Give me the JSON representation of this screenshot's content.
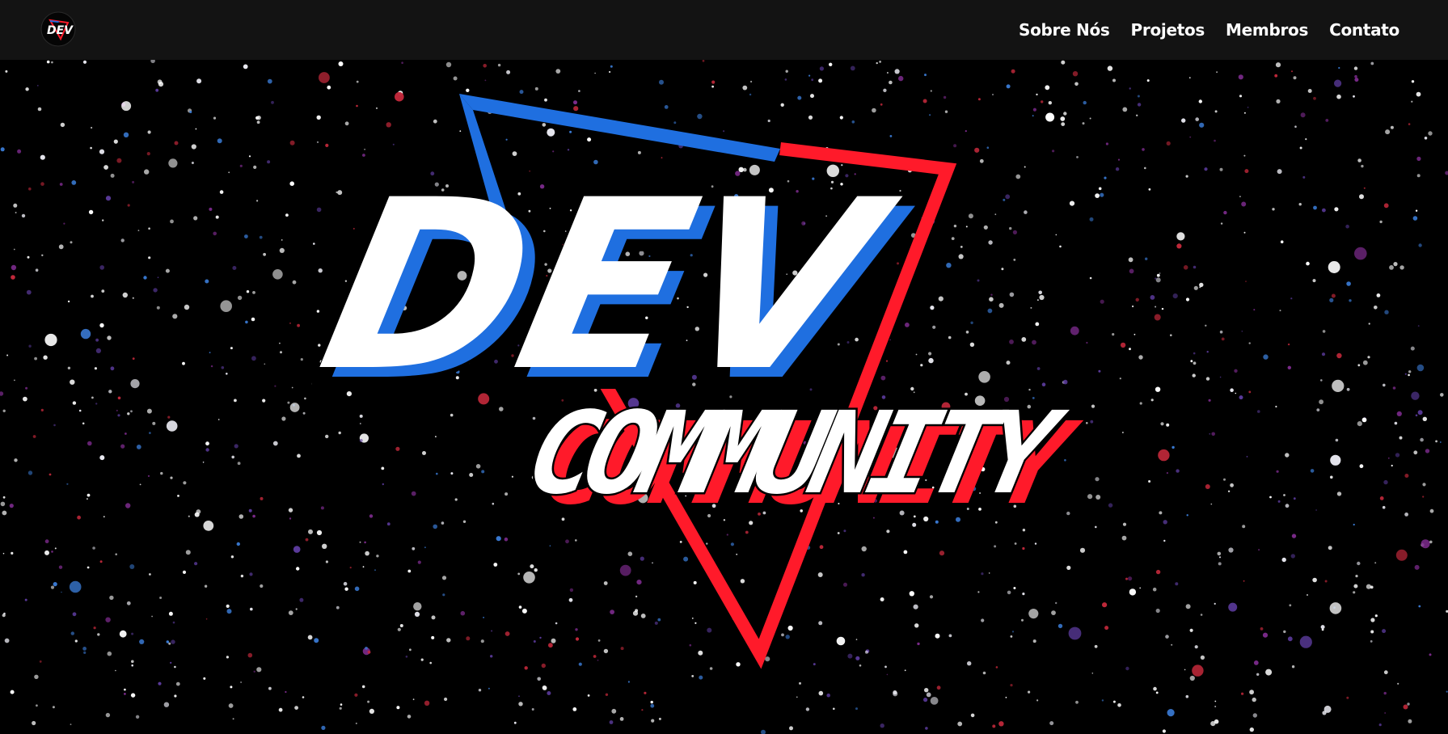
{
  "header": {
    "logo_icon": "dev-community-logo-icon",
    "logo_text": "DEV",
    "nav": [
      {
        "label": "Sobre Nós"
      },
      {
        "label": "Projetos"
      },
      {
        "label": "Membros"
      },
      {
        "label": "Contato"
      }
    ]
  },
  "hero": {
    "logo_word_top": "DEV",
    "logo_word_bottom": "COMMUNITY",
    "colors": {
      "background": "#000000",
      "blue": "#1f6fe0",
      "red": "#ff1a2a",
      "white": "#ffffff",
      "navbar": "#131313"
    }
  }
}
